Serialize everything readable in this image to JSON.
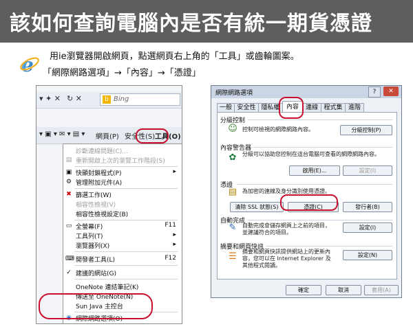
{
  "title": "該如何查詢電腦內是否有統一期貨憑證",
  "instructions": {
    "line1": "用ie瀏覽器開啟網頁，點選網頁右上角的「工具」或齒輪圖案。",
    "line2": "「網際網路選項」→「內容」→「憑證」"
  },
  "left": {
    "nav": "▾ ✦ ✕",
    "search_placeholder": "Bing",
    "toolbar": {
      "page": "網頁(P)",
      "safety": "安全性(S)",
      "tools": "工具(O)"
    },
    "menu": [
      {
        "label": "診斷連線問題(C)...",
        "shortcut": "",
        "disabled": true,
        "icon": ""
      },
      {
        "label": "重新開啟上次的瀏覽工作階段(S)",
        "shortcut": "",
        "disabled": true,
        "icon": ""
      },
      {
        "label": "快顯封鎖程式(P)",
        "shortcut": "",
        "disabled": false,
        "icon": "▣"
      },
      {
        "label": "管理附加元件(A)",
        "shortcut": "",
        "disabled": false,
        "icon": "⚙"
      },
      {
        "label": "篩選工作(W)",
        "shortcut": "",
        "disabled": false,
        "icon": "✖"
      },
      {
        "label": "相容性檢視(V)",
        "shortcut": "",
        "disabled": true,
        "icon": ""
      },
      {
        "label": "相容性檢視設定(B)",
        "shortcut": "",
        "disabled": false,
        "icon": ""
      },
      {
        "label": "全螢幕(F)",
        "shortcut": "F11",
        "disabled": false,
        "icon": "▭"
      },
      {
        "label": "工具列(T)",
        "shortcut": "",
        "disabled": false,
        "icon": ""
      },
      {
        "label": "瀏覽器列(X)",
        "shortcut": "",
        "disabled": false,
        "icon": ""
      },
      {
        "label": "開發者工具(L)",
        "shortcut": "F12",
        "disabled": false,
        "icon": "⌨"
      },
      {
        "label": "建議的網站(G)",
        "shortcut": "",
        "disabled": false,
        "icon": "✓"
      },
      {
        "label": "OneNote 連結筆記(K)",
        "shortcut": "",
        "disabled": false,
        "icon": ""
      },
      {
        "label": "傳送至 OneNote(N)",
        "shortcut": "",
        "disabled": false,
        "icon": ""
      },
      {
        "label": "Sun Java 主控台",
        "shortcut": "",
        "disabled": false,
        "icon": ""
      },
      {
        "label": "網際網路選項(O)",
        "shortcut": "",
        "disabled": false,
        "icon": "◉"
      }
    ]
  },
  "right": {
    "title": "網際網路選項",
    "tabs": [
      "一般",
      "安全性",
      "隱私權",
      "內容",
      "連線",
      "程式集",
      "進階"
    ],
    "sections": {
      "parental": {
        "head": "分級控制",
        "text": "控制可檢視的網際網路內容。",
        "button": "分級控制(P)"
      },
      "advisor": {
        "head": "內容警告器",
        "text": "分級可以協助您控制在這台電腦可查看的網際網路內容。",
        "enable": "啟用(E)...",
        "settings": "設定(I)"
      },
      "certs": {
        "head": "憑證",
        "text": "為加密的連線及身分識別使用憑證。",
        "clear_ssl": "清除 SSL 狀態(S)",
        "certificates": "憑證(C)",
        "publishers": "發行者(B)"
      },
      "autocomplete": {
        "head": "自動完成",
        "text": "自動完成會儲存網頁上之前的項目，並建議符合的項目。",
        "settings": "設定(I)"
      },
      "feeds": {
        "head": "摘要和網頁快訊",
        "text": "摘要和網頁快訊提供網站上的更新內容，您可以在 Internet Explorer 及其他程式閱讀。",
        "settings": "設定(N)"
      }
    },
    "footer": {
      "ok": "確定",
      "cancel": "取消",
      "apply": "套用(A)"
    }
  },
  "colors": {
    "title_bg": "#5e5e5e",
    "highlight_red": "#c8102e"
  }
}
